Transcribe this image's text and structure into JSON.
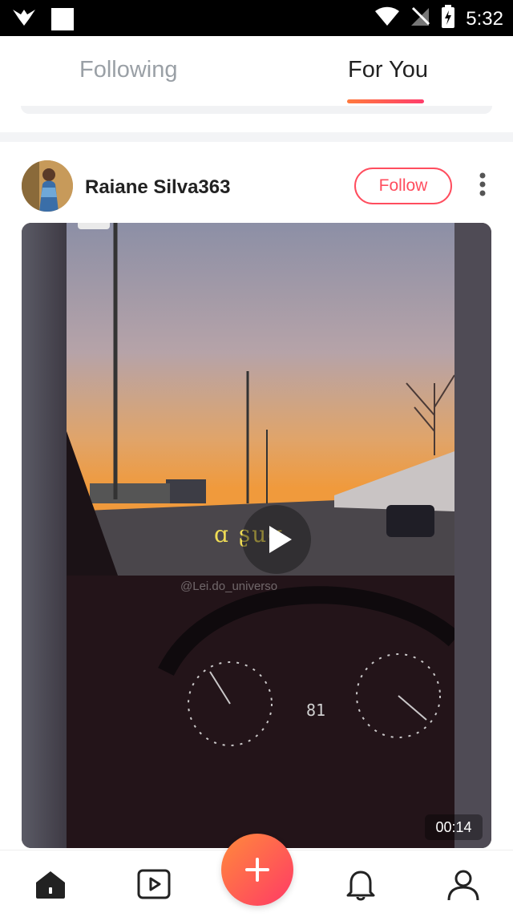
{
  "status_bar": {
    "time": "5:32",
    "icons": [
      "bird-logo-icon",
      "notification-square-icon",
      "wifi-icon",
      "no-signal-icon",
      "battery-charging-icon"
    ]
  },
  "tabs": [
    {
      "label": "Following",
      "active": false
    },
    {
      "label": "For You",
      "active": true
    }
  ],
  "post": {
    "username": "Raiane Silva363",
    "follow_label": "Follow",
    "video": {
      "caption": "ɑ ʂuɑ",
      "watermark": "@Lei.do_universo",
      "duration": "00:14"
    }
  },
  "bottom_nav": {
    "items": [
      "home-icon",
      "video-icon",
      "add-icon",
      "bell-icon",
      "profile-icon"
    ]
  },
  "colors": {
    "accent": "#ff4d5e",
    "gradient_start": "#ff8a3b",
    "gradient_end": "#ff3a66"
  }
}
